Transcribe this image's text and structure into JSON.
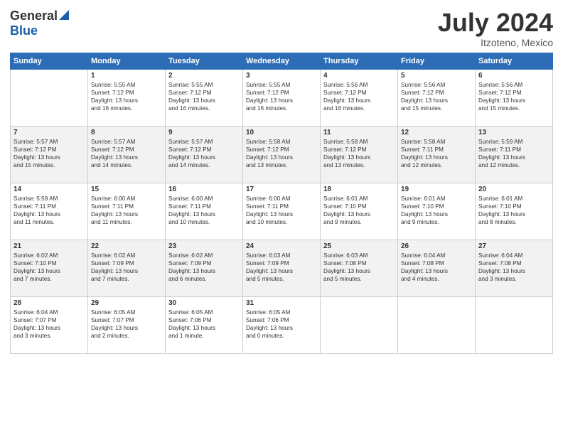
{
  "header": {
    "logo_general": "General",
    "logo_blue": "Blue",
    "month_year": "July 2024",
    "location": "Itzoteno, Mexico"
  },
  "days_of_week": [
    "Sunday",
    "Monday",
    "Tuesday",
    "Wednesday",
    "Thursday",
    "Friday",
    "Saturday"
  ],
  "weeks": [
    [
      {
        "day": "",
        "text": ""
      },
      {
        "day": "1",
        "text": "Sunrise: 5:55 AM\nSunset: 7:12 PM\nDaylight: 13 hours\nand 16 minutes."
      },
      {
        "day": "2",
        "text": "Sunrise: 5:55 AM\nSunset: 7:12 PM\nDaylight: 13 hours\nand 16 minutes."
      },
      {
        "day": "3",
        "text": "Sunrise: 5:55 AM\nSunset: 7:12 PM\nDaylight: 13 hours\nand 16 minutes."
      },
      {
        "day": "4",
        "text": "Sunrise: 5:56 AM\nSunset: 7:12 PM\nDaylight: 13 hours\nand 16 minutes."
      },
      {
        "day": "5",
        "text": "Sunrise: 5:56 AM\nSunset: 7:12 PM\nDaylight: 13 hours\nand 15 minutes."
      },
      {
        "day": "6",
        "text": "Sunrise: 5:56 AM\nSunset: 7:12 PM\nDaylight: 13 hours\nand 15 minutes."
      }
    ],
    [
      {
        "day": "7",
        "text": "Sunrise: 5:57 AM\nSunset: 7:12 PM\nDaylight: 13 hours\nand 15 minutes."
      },
      {
        "day": "8",
        "text": "Sunrise: 5:57 AM\nSunset: 7:12 PM\nDaylight: 13 hours\nand 14 minutes."
      },
      {
        "day": "9",
        "text": "Sunrise: 5:57 AM\nSunset: 7:12 PM\nDaylight: 13 hours\nand 14 minutes."
      },
      {
        "day": "10",
        "text": "Sunrise: 5:58 AM\nSunset: 7:12 PM\nDaylight: 13 hours\nand 13 minutes."
      },
      {
        "day": "11",
        "text": "Sunrise: 5:58 AM\nSunset: 7:12 PM\nDaylight: 13 hours\nand 13 minutes."
      },
      {
        "day": "12",
        "text": "Sunrise: 5:58 AM\nSunset: 7:11 PM\nDaylight: 13 hours\nand 12 minutes."
      },
      {
        "day": "13",
        "text": "Sunrise: 5:59 AM\nSunset: 7:11 PM\nDaylight: 13 hours\nand 12 minutes."
      }
    ],
    [
      {
        "day": "14",
        "text": "Sunrise: 5:59 AM\nSunset: 7:11 PM\nDaylight: 13 hours\nand 11 minutes."
      },
      {
        "day": "15",
        "text": "Sunrise: 6:00 AM\nSunset: 7:11 PM\nDaylight: 13 hours\nand 11 minutes."
      },
      {
        "day": "16",
        "text": "Sunrise: 6:00 AM\nSunset: 7:11 PM\nDaylight: 13 hours\nand 10 minutes."
      },
      {
        "day": "17",
        "text": "Sunrise: 6:00 AM\nSunset: 7:11 PM\nDaylight: 13 hours\nand 10 minutes."
      },
      {
        "day": "18",
        "text": "Sunrise: 6:01 AM\nSunset: 7:10 PM\nDaylight: 13 hours\nand 9 minutes."
      },
      {
        "day": "19",
        "text": "Sunrise: 6:01 AM\nSunset: 7:10 PM\nDaylight: 13 hours\nand 9 minutes."
      },
      {
        "day": "20",
        "text": "Sunrise: 6:01 AM\nSunset: 7:10 PM\nDaylight: 13 hours\nand 8 minutes."
      }
    ],
    [
      {
        "day": "21",
        "text": "Sunrise: 6:02 AM\nSunset: 7:10 PM\nDaylight: 13 hours\nand 7 minutes."
      },
      {
        "day": "22",
        "text": "Sunrise: 6:02 AM\nSunset: 7:09 PM\nDaylight: 13 hours\nand 7 minutes."
      },
      {
        "day": "23",
        "text": "Sunrise: 6:02 AM\nSunset: 7:09 PM\nDaylight: 13 hours\nand 6 minutes."
      },
      {
        "day": "24",
        "text": "Sunrise: 6:03 AM\nSunset: 7:09 PM\nDaylight: 13 hours\nand 5 minutes."
      },
      {
        "day": "25",
        "text": "Sunrise: 6:03 AM\nSunset: 7:08 PM\nDaylight: 13 hours\nand 5 minutes."
      },
      {
        "day": "26",
        "text": "Sunrise: 6:04 AM\nSunset: 7:08 PM\nDaylight: 13 hours\nand 4 minutes."
      },
      {
        "day": "27",
        "text": "Sunrise: 6:04 AM\nSunset: 7:08 PM\nDaylight: 13 hours\nand 3 minutes."
      }
    ],
    [
      {
        "day": "28",
        "text": "Sunrise: 6:04 AM\nSunset: 7:07 PM\nDaylight: 13 hours\nand 3 minutes."
      },
      {
        "day": "29",
        "text": "Sunrise: 6:05 AM\nSunset: 7:07 PM\nDaylight: 13 hours\nand 2 minutes."
      },
      {
        "day": "30",
        "text": "Sunrise: 6:05 AM\nSunset: 7:06 PM\nDaylight: 13 hours\nand 1 minute."
      },
      {
        "day": "31",
        "text": "Sunrise: 6:05 AM\nSunset: 7:06 PM\nDaylight: 13 hours\nand 0 minutes."
      },
      {
        "day": "",
        "text": ""
      },
      {
        "day": "",
        "text": ""
      },
      {
        "day": "",
        "text": ""
      }
    ]
  ]
}
